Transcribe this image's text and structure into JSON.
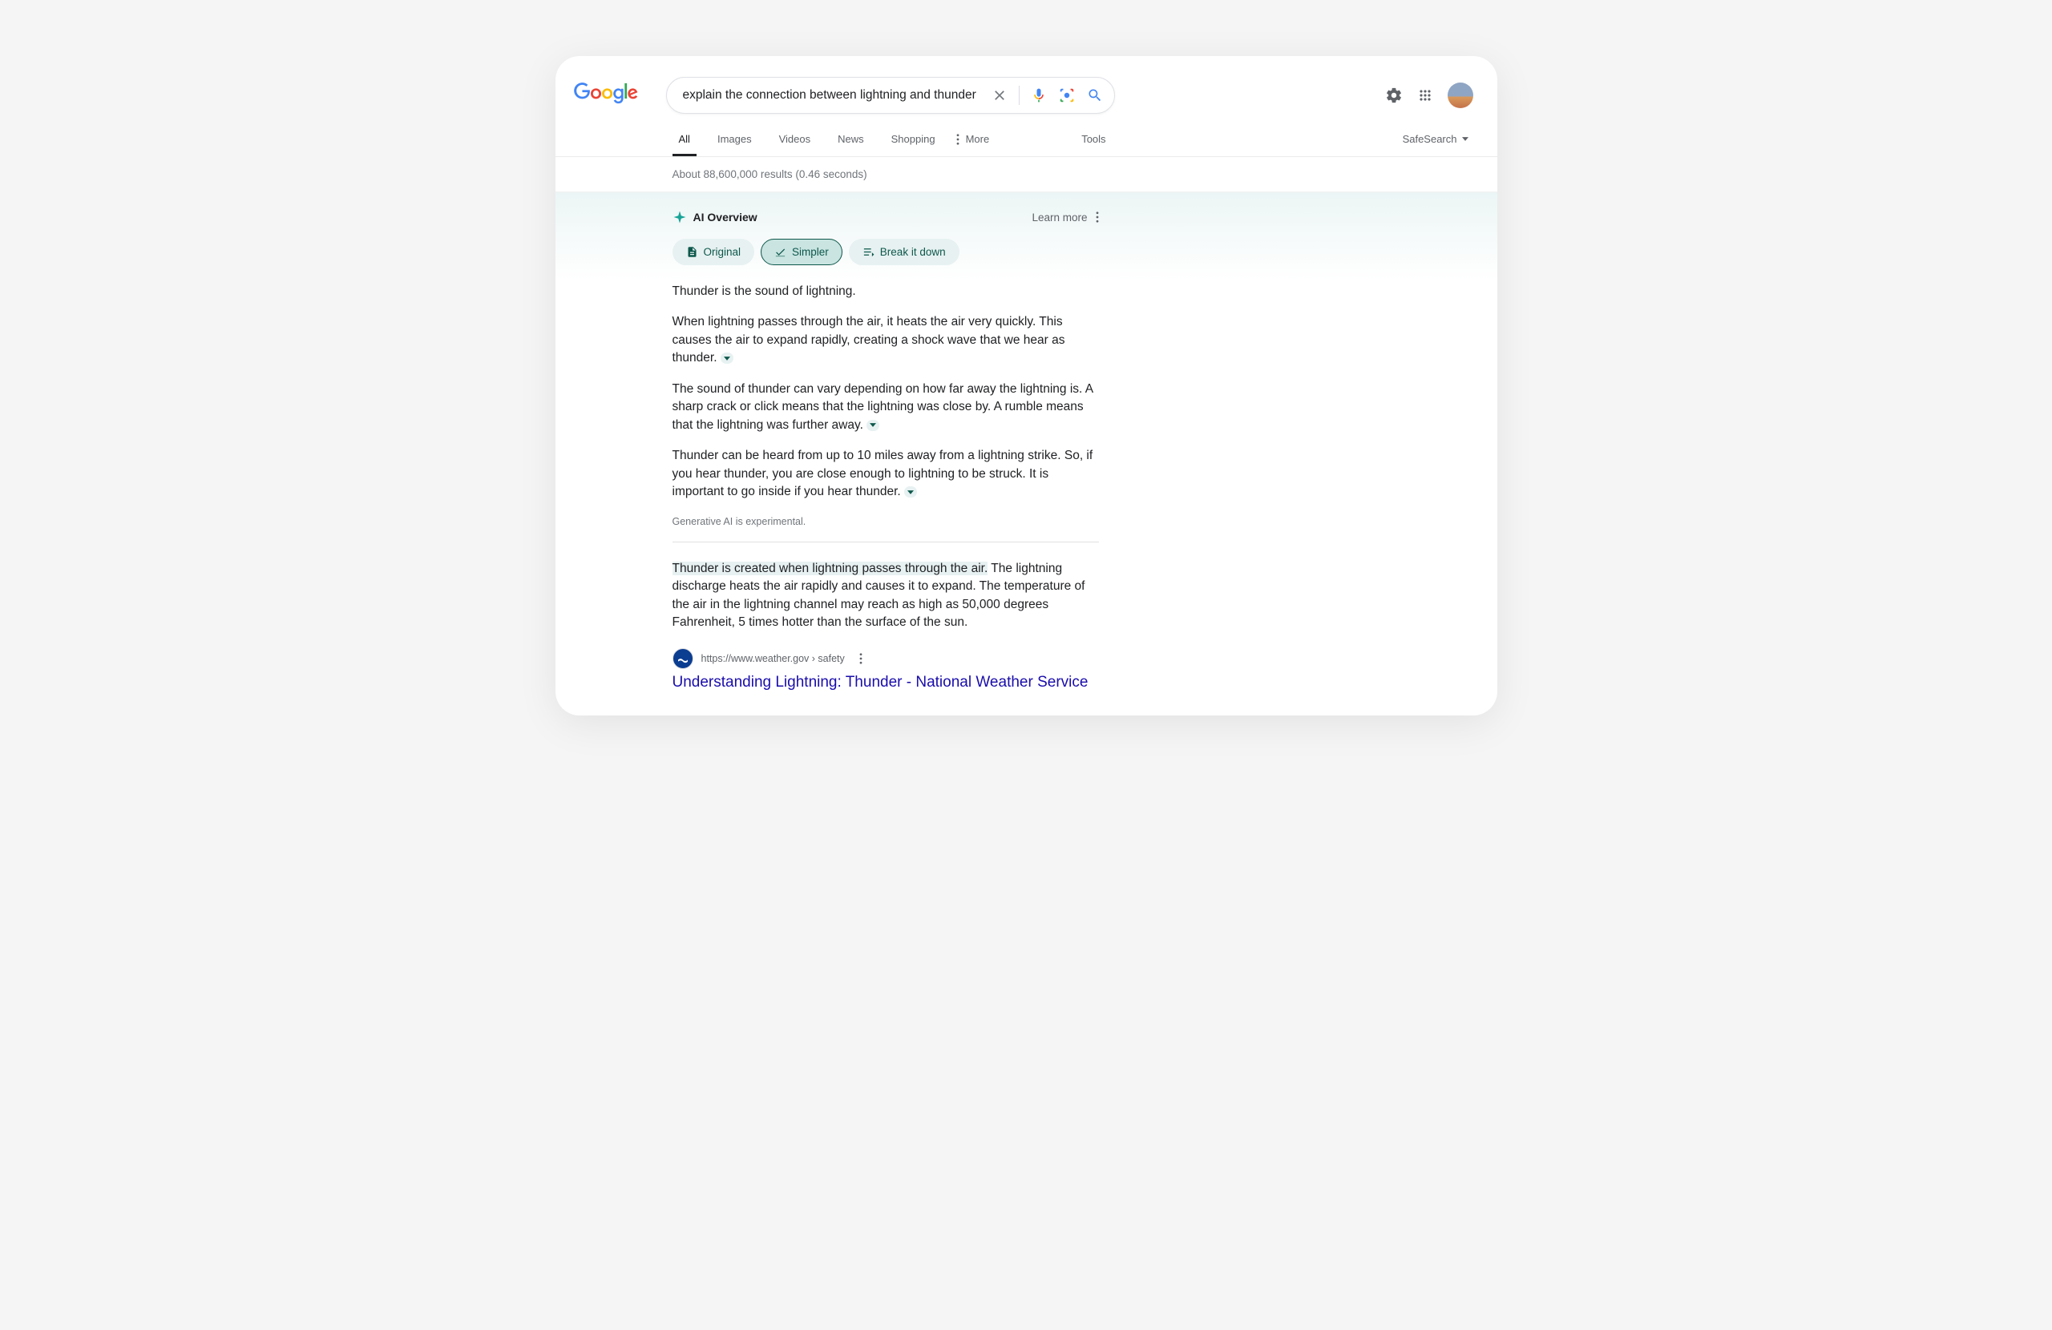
{
  "header": {
    "search_value": "explain the connection between lightning and thunder"
  },
  "nav": {
    "tabs": [
      "All",
      "Images",
      "Videos",
      "News",
      "Shopping"
    ],
    "more_label": "More",
    "tools_label": "Tools",
    "safesearch_label": "SafeSearch"
  },
  "stats": "About 88,600,000 results (0.46 seconds)",
  "ai": {
    "title": "AI Overview",
    "learn_more": "Learn more",
    "chips": {
      "original": "Original",
      "simpler": "Simpler",
      "break": "Break it down"
    },
    "p1": "Thunder is the sound of lightning.",
    "p2": "When lightning passes through the air, it heats the air very quickly. This causes the air to expand rapidly, creating a shock wave that we hear as thunder.",
    "p3": "The sound of thunder can vary depending on how far away the lightning is. A sharp crack or click means that the lightning was close by. A rumble means that the lightning was further away.",
    "p4": "Thunder can be heard from up to 10 miles away from a lightning strike. So, if you hear thunder, you are close enough to lightning to be struck. It is important to go inside if you hear thunder.",
    "disclaimer": "Generative AI is experimental."
  },
  "result": {
    "snippet_highlight": "Thunder is created when lightning passes through the air.",
    "snippet_rest": " The lightning discharge heats the air rapidly and causes it to expand. The temperature of the air in the lightning channel may reach as high as 50,000 degrees Fahrenheit, 5 times hotter than the surface of the sun.",
    "source_url": "https://www.weather.gov › safety",
    "title": "Understanding Lightning: Thunder - National Weather Service"
  }
}
